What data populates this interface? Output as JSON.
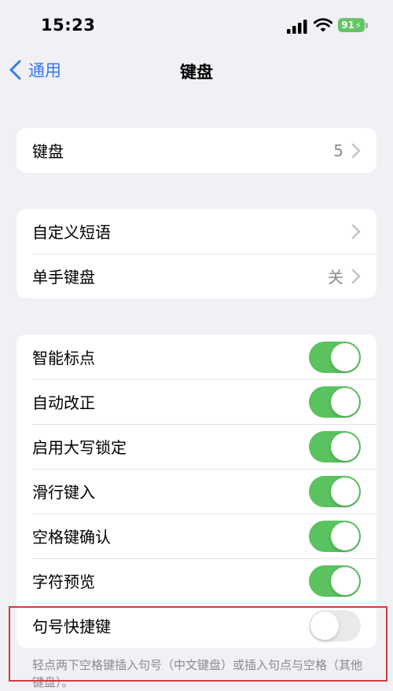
{
  "status_bar": {
    "time": "15:23",
    "battery": "91"
  },
  "nav": {
    "back_label": "通用",
    "title": "键盘"
  },
  "group1": {
    "items": [
      {
        "label": "键盘",
        "value": "5"
      }
    ]
  },
  "group2": {
    "items": [
      {
        "label": "自定义短语"
      },
      {
        "label": "单手键盘",
        "value": "关"
      }
    ]
  },
  "group3": {
    "items": [
      {
        "label": "智能标点",
        "on": true
      },
      {
        "label": "自动改正",
        "on": true
      },
      {
        "label": "启用大写锁定",
        "on": true
      },
      {
        "label": "滑行键入",
        "on": true
      },
      {
        "label": "空格键确认",
        "on": true
      },
      {
        "label": "字符预览",
        "on": true
      },
      {
        "label": "句号快捷键",
        "on": false
      }
    ],
    "footer": "轻点两下空格键插入句号（中文键盘）或插入句点与空格（其他键盘）。"
  },
  "colors": {
    "accent": "#3478f6",
    "toggle_on": "#5ac25e",
    "highlight": "#d43a3f"
  }
}
